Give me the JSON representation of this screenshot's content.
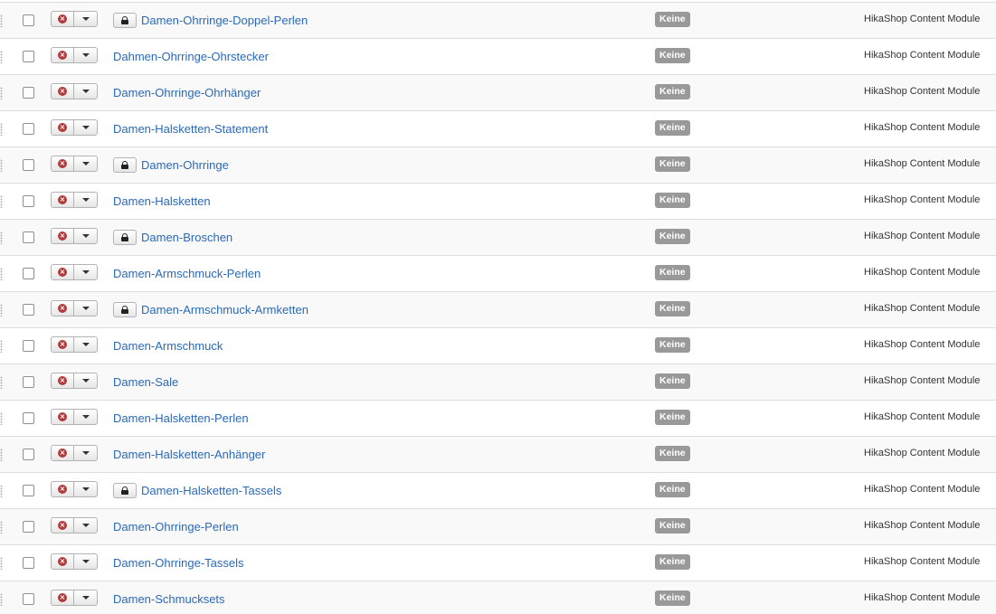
{
  "rows": [
    {
      "title": "Damen-Ohrringe-Doppel-Perlen",
      "locked": true,
      "access": "Keine",
      "type": "HikaShop Content Module"
    },
    {
      "title": "Dahmen-Ohrringe-Ohrstecker",
      "locked": false,
      "access": "Keine",
      "type": "HikaShop Content Module"
    },
    {
      "title": "Damen-Ohrringe-Ohrhänger",
      "locked": false,
      "access": "Keine",
      "type": "HikaShop Content Module"
    },
    {
      "title": "Damen-Halsketten-Statement",
      "locked": false,
      "access": "Keine",
      "type": "HikaShop Content Module"
    },
    {
      "title": "Damen-Ohrringe",
      "locked": true,
      "access": "Keine",
      "type": "HikaShop Content Module"
    },
    {
      "title": "Damen-Halsketten",
      "locked": false,
      "access": "Keine",
      "type": "HikaShop Content Module"
    },
    {
      "title": "Damen-Broschen",
      "locked": true,
      "access": "Keine",
      "type": "HikaShop Content Module"
    },
    {
      "title": "Damen-Armschmuck-Perlen",
      "locked": false,
      "access": "Keine",
      "type": "HikaShop Content Module"
    },
    {
      "title": "Damen-Armschmuck-Armketten",
      "locked": true,
      "access": "Keine",
      "type": "HikaShop Content Module"
    },
    {
      "title": "Damen-Armschmuck",
      "locked": false,
      "access": "Keine",
      "type": "HikaShop Content Module"
    },
    {
      "title": "Damen-Sale",
      "locked": false,
      "access": "Keine",
      "type": "HikaShop Content Module"
    },
    {
      "title": "Damen-Halsketten-Perlen",
      "locked": false,
      "access": "Keine",
      "type": "HikaShop Content Module"
    },
    {
      "title": "Damen-Halsketten-Anhänger",
      "locked": false,
      "access": "Keine",
      "type": "HikaShop Content Module"
    },
    {
      "title": "Damen-Halsketten-Tassels",
      "locked": true,
      "access": "Keine",
      "type": "HikaShop Content Module"
    },
    {
      "title": "Damen-Ohrringe-Perlen",
      "locked": false,
      "access": "Keine",
      "type": "HikaShop Content Module"
    },
    {
      "title": "Damen-Ohrringe-Tassels",
      "locked": false,
      "access": "Keine",
      "type": "HikaShop Content Module"
    },
    {
      "title": "Damen-Schmucksets",
      "locked": false,
      "access": "Keine",
      "type": "HikaShop Content Module"
    }
  ],
  "status_symbol": "×",
  "icons": {
    "status": "unpublished-icon",
    "toggle": "caret-down-icon",
    "lock": "lock-icon",
    "drag": "drag-handle-icon"
  },
  "colors": {
    "link": "#2a69b8",
    "badge": "#999999",
    "unpublished": "#b33a3a",
    "row_alt": "#f9f9f9"
  }
}
